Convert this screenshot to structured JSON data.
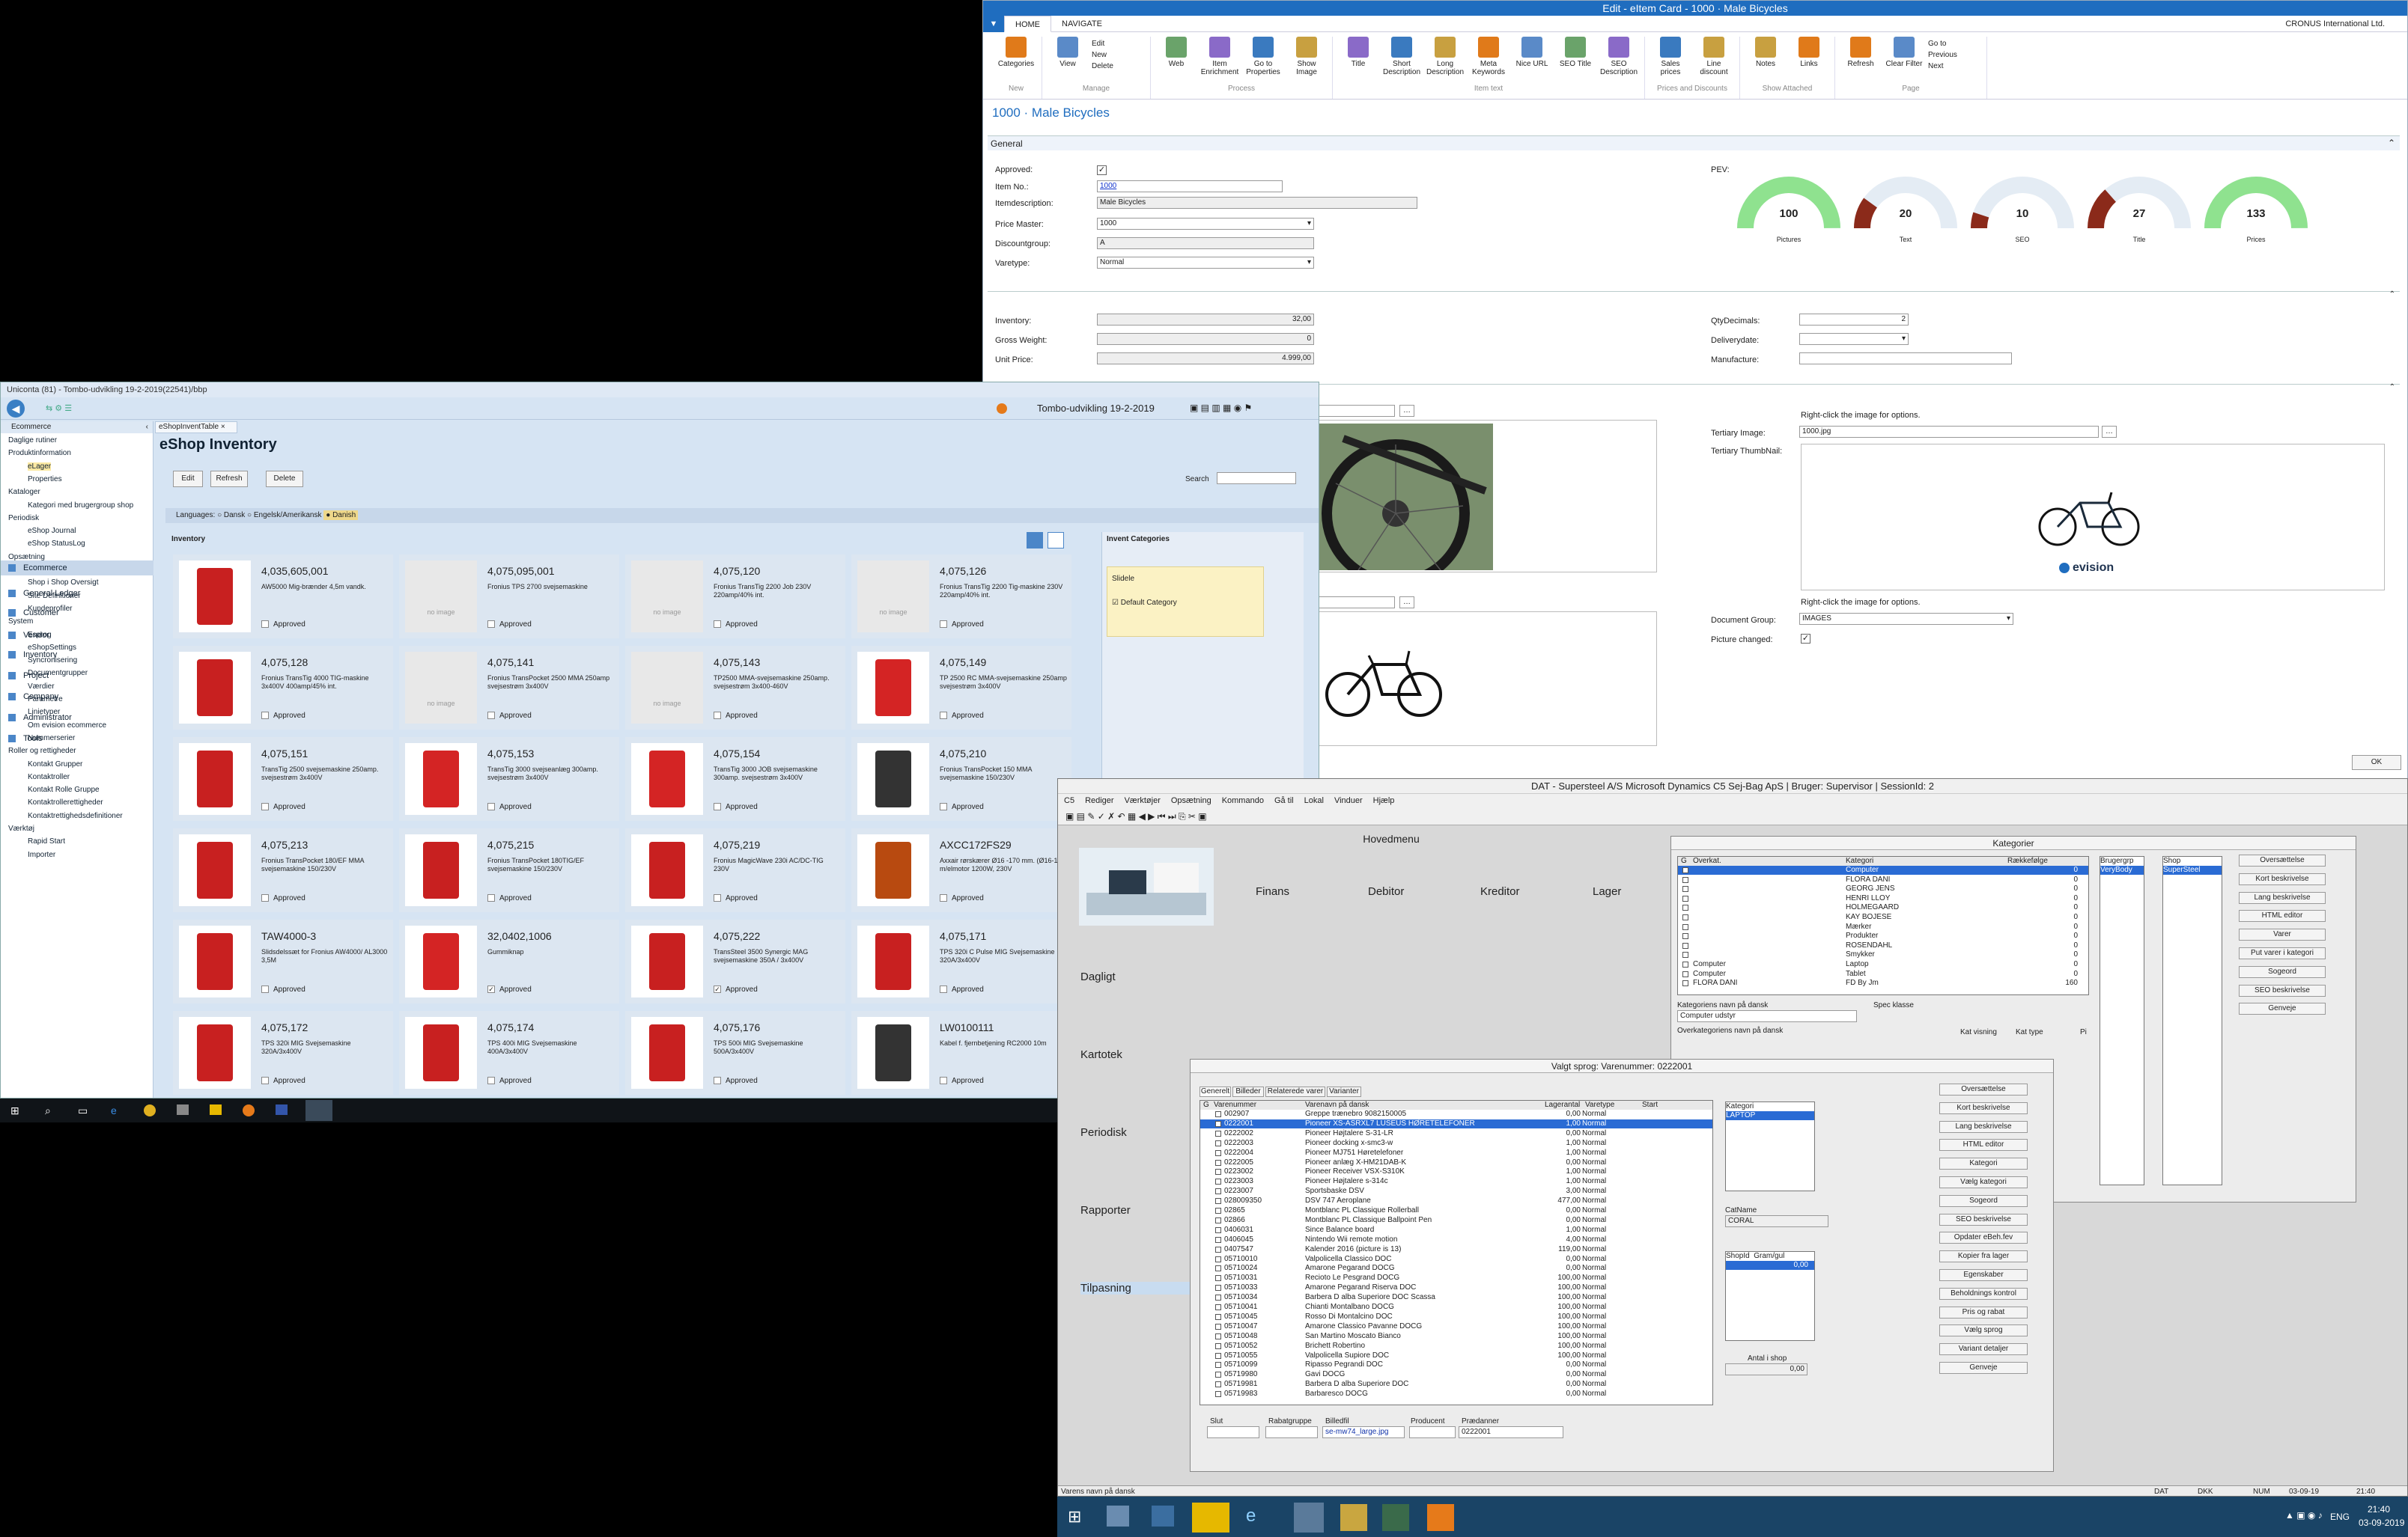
{
  "nav": {
    "window_title": "Edit - eItem Card - 1000 · Male Bicycles",
    "tab_home": "HOME",
    "tab_navigate": "NAVIGATE",
    "company": "CRONUS International Ltd.",
    "ribbon": [
      {
        "group": "New",
        "buttons": [
          "Categories"
        ]
      },
      {
        "group": "Manage",
        "buttons": [
          "View"
        ],
        "small": [
          "Edit",
          "New",
          "Delete"
        ]
      },
      {
        "group": "Process",
        "buttons": [
          "Web",
          "Item Enrichment",
          "Go to Properties",
          "Show Image"
        ]
      },
      {
        "group": "Item text",
        "buttons": [
          "Title",
          "Short Description",
          "Long Description",
          "Meta Keywords",
          "Nice URL",
          "SEO Title",
          "SEO Description"
        ]
      },
      {
        "group": "Prices and Discounts",
        "buttons": [
          "Sales prices",
          "Line discount"
        ]
      },
      {
        "group": "Show Attached",
        "buttons": [
          "Notes",
          "Links"
        ]
      },
      {
        "group": "Page",
        "buttons": [
          "Refresh",
          "Clear Filter"
        ],
        "small": [
          "Go to",
          "Previous",
          "Next"
        ]
      }
    ],
    "page_title": "1000 · Male Bicycles",
    "general_header": "General",
    "fields": {
      "approved_label": "Approved:",
      "item_no_label": "Item No.:",
      "item_no": "1000",
      "itemdesc_label": "Itemdescription:",
      "itemdesc": "Male Bicycles",
      "price_master_label": "Price Master:",
      "price_master": "1000",
      "discountgroup_label": "Discountgroup:",
      "discountgroup": "A",
      "varetype_label": "Varetype:",
      "varetype": "Normal",
      "pev_label": "PEV:",
      "inventory_label": "Inventory:",
      "inventory": "32,00",
      "gross_weight_label": "Gross Weight:",
      "gross_weight": "0",
      "unit_price_label": "Unit Price:",
      "unit_price": "4.999,00",
      "qtydecimals_label": "QtyDecimals:",
      "qtydecimals": "2",
      "deliverydate_label": "Deliverydate:",
      "manufacture_label": "Manufacture:",
      "tertiary_image_label": "Tertiary Image:",
      "tertiary_image": "1000.jpg",
      "tertiary_thumb_label": "Tertiary ThumbNail:",
      "right_click_hint": "Right-click the image for options.",
      "document_group_label": "Document Group:",
      "document_group": "IMAGES",
      "picture_changed_label": "Picture changed:",
      "logo_text": "evision",
      "ok": "OK"
    },
    "gauges": [
      {
        "value": "100",
        "label": "Pictures",
        "fraction": 1.0,
        "color": "#8fe28f"
      },
      {
        "value": "20",
        "label": "Text",
        "fraction": 0.2,
        "color": "#8b2a1a"
      },
      {
        "value": "10",
        "label": "SEO",
        "fraction": 0.1,
        "color": "#8b2a1a"
      },
      {
        "value": "27",
        "label": "Title",
        "fraction": 0.27,
        "color": "#8b2a1a"
      },
      {
        "value": "133",
        "label": "Prices",
        "fraction": 1.0,
        "color": "#8fe28f"
      }
    ]
  },
  "uni": {
    "window_title": "Uniconta (81) - Tombo-udvikling 19-2-2019(22541)/bbp",
    "company_select": "Tombo-udvikling 19-2-2019",
    "tab": "eShopInventTable",
    "section": "Ecommerce",
    "tree": [
      {
        "t": "Daglige rutiner",
        "l": 0
      },
      {
        "t": "Produktinformation",
        "l": 0
      },
      {
        "t": "eLager",
        "l": 1,
        "sel": true
      },
      {
        "t": "Properties",
        "l": 1
      },
      {
        "t": "Kataloger",
        "l": 0
      },
      {
        "t": "Kategori med brugergroup shop",
        "l": 1
      },
      {
        "t": "Periodisk",
        "l": 0
      },
      {
        "t": "eShop Journal",
        "l": 1
      },
      {
        "t": "eShop StatusLog",
        "l": 1
      },
      {
        "t": "Opsætning",
        "l": 0
      },
      {
        "t": "Katalog skabeloner",
        "l": 1
      },
      {
        "t": "Shop i Shop Oversigt",
        "l": 1
      },
      {
        "t": "Site Definitioner",
        "l": 1
      },
      {
        "t": "Kundeprofiler",
        "l": 1
      },
      {
        "t": "System",
        "l": 0
      },
      {
        "t": "Esprog",
        "l": 1
      },
      {
        "t": "eShopSettings",
        "l": 1
      },
      {
        "t": "Syncronisering",
        "l": 1
      },
      {
        "t": "Documentgrupper",
        "l": 1
      },
      {
        "t": "Værdier",
        "l": 1
      },
      {
        "t": "Parametre",
        "l": 1
      },
      {
        "t": "Linietyper",
        "l": 1
      },
      {
        "t": "Om evision ecommerce",
        "l": 1
      },
      {
        "t": "Nummerserier",
        "l": 1
      },
      {
        "t": "Roller og rettigheder",
        "l": 0
      },
      {
        "t": "Kontakt Grupper",
        "l": 1
      },
      {
        "t": "Kontaktroller",
        "l": 1
      },
      {
        "t": "Kontakt Rolle Gruppe",
        "l": 1
      },
      {
        "t": "Kontaktrollerettigheder",
        "l": 1
      },
      {
        "t": "Kontaktrettighedsdefinitioner",
        "l": 1
      },
      {
        "t": "Værktøj",
        "l": 0
      },
      {
        "t": "Rapid Start",
        "l": 1
      },
      {
        "t": "Importer",
        "l": 1
      }
    ],
    "nav_modules": [
      "Ecommerce",
      "General Ledger",
      "Customer",
      "Vendor",
      "Inventory",
      "Project",
      "Company",
      "Administrator",
      "Tools"
    ],
    "heading": "eShop Inventory",
    "btn_edit": "Edit",
    "btn_refresh": "Refresh",
    "btn_delete": "Delete",
    "search_label": "Search",
    "languages_label": "Languages:",
    "lang1": "Dansk",
    "lang2": "Engelsk/Amerikansk",
    "lang3": "Danish",
    "inventory_label": "Inventory",
    "invent_categories": "Invent Categories",
    "cat_group": "Slidele",
    "cat_default": "Default Category",
    "no_image": "no image",
    "approved": "Approved",
    "tiles": [
      {
        "code": "4,035,605,001",
        "desc": "AW5000 Mig-brænder 4,5m vandk.",
        "img": "welder",
        "ok": false
      },
      {
        "code": "4,075,095,001",
        "desc": "Fronius TPS 2700 svejsemaskine",
        "img": "none",
        "ok": false
      },
      {
        "code": "4,075,120",
        "desc": "Fronius TransTig 2200 Job 230V 220amp/40% int.",
        "img": "none",
        "ok": false
      },
      {
        "code": "4,075,126",
        "desc": "Fronius TransTig 2200 Tig-maskine 230V 220amp/40% int.",
        "img": "none",
        "ok": false
      },
      {
        "code": "4,075,128",
        "desc": "Fronius TransTig 4000 TIG-maskine 3x400V 400amp/45% int.",
        "img": "welder",
        "ok": false
      },
      {
        "code": "4,075,141",
        "desc": "Fronius TransPocket 2500 MMA 250amp svejsestrøm 3x400V",
        "img": "none",
        "ok": false
      },
      {
        "code": "4,075,143",
        "desc": "TP2500 MMA-svejsemaskine 250amp. svejsestrøm 3x400-460V",
        "img": "none",
        "ok": false
      },
      {
        "code": "4,075,149",
        "desc": "TP 2500 RC MMA-svejsemaskine 250amp svejsestrøm 3x400V",
        "img": "red",
        "ok": false
      },
      {
        "code": "4,075,151",
        "desc": "TransTig 2500 svejsemaskine 250amp. svejsestrøm 3x400V",
        "img": "welder",
        "ok": false
      },
      {
        "code": "4,075,153",
        "desc": "TransTig 3000 svejseanlæg 300amp. svejsestrøm 3x400V",
        "img": "red",
        "ok": false
      },
      {
        "code": "4,075,154",
        "desc": "TransTig 3000 JOB svejsemaskine 300amp. svejsestrøm 3x400V",
        "img": "red",
        "ok": false
      },
      {
        "code": "4,075,210",
        "desc": "Fronius TransPocket 150 MMA svejsemaskine 150/230V",
        "img": "reel",
        "ok": false
      },
      {
        "code": "4,075,213",
        "desc": "Fronius TransPocket 180/EF MMA svejsemaskine 150/230V",
        "img": "welder",
        "ok": false
      },
      {
        "code": "4,075,215",
        "desc": "Fronius TransPocket 180TIG/EF svejsemaskine 150/230V",
        "img": "welder",
        "ok": false
      },
      {
        "code": "4,075,219",
        "desc": "Fronius MagicWave 230i AC/DC-TIG 230V",
        "img": "welder",
        "ok": false
      },
      {
        "code": "AXCC172FS29",
        "desc": "Axxair rørskærer Ø16 -170 mm. (Ø16-118) m/elmotor 1200W, 230V",
        "img": "orange",
        "ok": false
      },
      {
        "code": "TAW4000-3",
        "desc": "Slidsdelssæt for Fronius AW4000/ AL3000 3,5M",
        "img": "welder",
        "ok": false
      },
      {
        "code": "32,0402,1006",
        "desc": "Gummiknap",
        "img": "red",
        "ok": true
      },
      {
        "code": "4,075,222",
        "desc": "TransSteel 3500 Synergic MAG svejsemaskine 350A / 3x400V",
        "img": "welder",
        "ok": true
      },
      {
        "code": "4,075,171",
        "desc": "TPS 320i C Pulse MIG Svejsemaskine 320A/3x400V",
        "img": "welder",
        "ok": false
      },
      {
        "code": "4,075,172",
        "desc": "TPS 320i MIG Svejsemaskine 320A/3x400V",
        "img": "welder",
        "ok": false
      },
      {
        "code": "4,075,174",
        "desc": "TPS 400i MIG Svejsemaskine 400A/3x400V",
        "img": "welder",
        "ok": false
      },
      {
        "code": "4,075,176",
        "desc": "TPS 500i MIG Svejsemaskine 500A/3x400V",
        "img": "welder",
        "ok": false
      },
      {
        "code": "LW0100111",
        "desc": "Kabel f. fjernbetjening RC2000 10m",
        "img": "reel",
        "ok": false
      }
    ]
  },
  "c5": {
    "window_title": "DAT - Supersteel A/S      Microsoft Dynamics C5  Sej-Bag ApS      | Bruger: Supervisor | SessionId: 2",
    "menu": [
      "C5",
      "Rediger",
      "Værktøjer",
      "Opsætning",
      "Kommando",
      "Gå til",
      "Lokal",
      "Vinduer",
      "Hjælp"
    ],
    "hovedmenu": "Hovedmenu",
    "modules": [
      "Finans",
      "Debitor",
      "Kreditor",
      "Lager"
    ],
    "left_menu": [
      "Dagligt",
      "Kartotek",
      "Periodisk",
      "Rapporter",
      "Tilpasning"
    ],
    "kategorier": {
      "title": "Kategorier",
      "headers": [
        "G",
        "Overkat.",
        "Kategori",
        "Rækkefølge"
      ],
      "rows": [
        {
          "cat": "Computer",
          "order": "0",
          "hi": true
        },
        {
          "cat": "FLORA DANI",
          "order": "0"
        },
        {
          "cat": "GEORG JENS",
          "order": "0"
        },
        {
          "cat": "HENRI LLOY",
          "order": "0"
        },
        {
          "cat": "HOLMEGAARD",
          "order": "0"
        },
        {
          "cat": "KAY BOJESE",
          "order": "0"
        },
        {
          "cat": "Mærker",
          "order": "0"
        },
        {
          "cat": "Produkter",
          "order": "0"
        },
        {
          "cat": "ROSENDAHL",
          "order": "0"
        },
        {
          "cat": "Smykker",
          "order": "0"
        },
        {
          "parent": "Computer",
          "cat": "Laptop",
          "order": "0"
        },
        {
          "parent": "Computer",
          "cat": "Tablet",
          "order": "0"
        },
        {
          "parent": "FLORA DANI",
          "cat": "FD By Jm",
          "order": "160"
        }
      ],
      "brugergrp": "Brugergrp",
      "brugergrp_val": "VeryBody",
      "shop": "Shop",
      "shop_val": "SuperSteel",
      "cat_name_label": "Kategoriens navn på dansk",
      "cat_name": "Computer udstyr",
      "spec_label": "Spec klasse",
      "overkat_label": "Overkategoriens navn på dansk",
      "kat_visning": "Kat visning",
      "kat_type": "Kat type",
      "pi": "Pi",
      "buttons": [
        "Oversættelse",
        "Kort beskrivelse",
        "Lang beskrivelse",
        "HTML editor",
        "Varer",
        "Put varer i kategori",
        "Sogeord",
        "SEO beskrivelse",
        "Genveje"
      ]
    },
    "sprog": {
      "title": "Valgt sprog:  Varenummer: 0222001",
      "tabs": [
        "Generelt",
        "Billeder",
        "Relaterede varer",
        "Varianter"
      ],
      "headers": [
        "G",
        "Varenummer",
        "Varenavn på dansk",
        "Lagerantal",
        "Varetype",
        "Start"
      ],
      "rows": [
        [
          "002907",
          "Greppe trænebro 9082150005",
          "0,00",
          "Normal"
        ],
        [
          "0222001",
          "Pioneer XS-ASRXL7 LUSEUS HØRETELEFONER",
          "1,00",
          "Normal"
        ],
        [
          "0222002",
          "Pioneer Højtalere S-31-LR",
          "0,00",
          "Normal"
        ],
        [
          "0222003",
          "Pioneer docking x-smc3-w",
          "1,00",
          "Normal"
        ],
        [
          "0222004",
          "Pioneer MJ751 Høretelefoner",
          "1,00",
          "Normal"
        ],
        [
          "0222005",
          "Pioneer anlæg X-HM21DAB-K",
          "0,00",
          "Normal"
        ],
        [
          "0223002",
          "Pioneer Receiver VSX-S310K",
          "1,00",
          "Normal"
        ],
        [
          "0223003",
          "Pioneer Højtalere s-314c",
          "1,00",
          "Normal"
        ],
        [
          "0223007",
          "Sportsbaske DSV",
          "3,00",
          "Normal"
        ],
        [
          "028009350",
          "DSV 747 Aeroplane",
          "477,00",
          "Normal"
        ],
        [
          "02865",
          "Montblanc PL Classique Rollerball",
          "0,00",
          "Normal"
        ],
        [
          "02866",
          "Montblanc PL Classique Ballpoint Pen",
          "0,00",
          "Normal"
        ],
        [
          "0406031",
          "Since Balance board",
          "1,00",
          "Normal"
        ],
        [
          "0406045",
          "Nintendo Wii remote motion",
          "4,00",
          "Normal"
        ],
        [
          "0407547",
          "Kalender 2016 (picture is 13)",
          "119,00",
          "Normal"
        ],
        [
          "05710010",
          "Valpolicella Classico DOC",
          "0,00",
          "Normal"
        ],
        [
          "05710024",
          "Amarone Pegarand DOCG",
          "0,00",
          "Normal"
        ],
        [
          "05710031",
          "Recioto Le Pesgrand DOCG",
          "100,00",
          "Normal"
        ],
        [
          "05710033",
          "Amarone Pegarand Riserva DOC",
          "100,00",
          "Normal"
        ],
        [
          "05710034",
          "Barbera D alba Superiore DOC Scassa",
          "100,00",
          "Normal"
        ],
        [
          "05710041",
          "Chianti Montalbano DOCG",
          "100,00",
          "Normal"
        ],
        [
          "05710045",
          "Rosso Di Montalcino DOC",
          "100,00",
          "Normal"
        ],
        [
          "05710047",
          "Amarone Classico Pavanne DOCG",
          "100,00",
          "Normal"
        ],
        [
          "05710048",
          "San Martino Moscato Bianco",
          "100,00",
          "Normal"
        ],
        [
          "05710052",
          "Brichett Robertino",
          "100,00",
          "Normal"
        ],
        [
          "05710055",
          "Valpolicella Supiore DOC",
          "100,00",
          "Normal"
        ],
        [
          "05710099",
          "Ripasso Pegrandi DOC",
          "0,00",
          "Normal"
        ],
        [
          "05719980",
          "Gavi DOCG",
          "0,00",
          "Normal"
        ],
        [
          "05719981",
          "Barbera D alba Superiore DOC",
          "0,00",
          "Normal"
        ],
        [
          "05719983",
          "Barbaresco DOCG",
          "0,00",
          "Normal"
        ]
      ],
      "kategori_label": "Kategori",
      "kategori_val": "LAPTOP",
      "catname_label": "CatName",
      "catname_val": "CORAL",
      "shopid_label": "ShopId",
      "gram_label": "Gram/gul",
      "gram_val": "0,00",
      "antal_label": "Antal i shop",
      "antal_val": "0,00",
      "slut": "Slut",
      "rabat": "Rabatgruppe",
      "billedfil": "Billedfil",
      "billedfil_val": "se-mw74_large.jpg",
      "producent": "Producent",
      "pradanner": "Prædanner",
      "pradanner_val": "0222001",
      "buttons": [
        "Oversættelse",
        "Kort beskrivelse",
        "Lang beskrivelse",
        "HTML editor",
        "Kategori",
        "Vælg kategori",
        "Sogeord",
        "SEO beskrivelse",
        "Opdater eBeh.fev",
        "Kopier fra lager",
        "Egenskaber",
        "Beholdnings kontrol",
        "Pris og rabat",
        "Vælg sprog",
        "Variant detaljer",
        "Genveje"
      ]
    },
    "status": {
      "left": "Varens navn på dansk",
      "dat": "DAT",
      "dkk": "DKK",
      "num": "NUM",
      "date": "03-09-19",
      "time": "21:40"
    },
    "tray": {
      "lang": "ENG",
      "time": "21:40",
      "date": "03-09-2019"
    }
  }
}
